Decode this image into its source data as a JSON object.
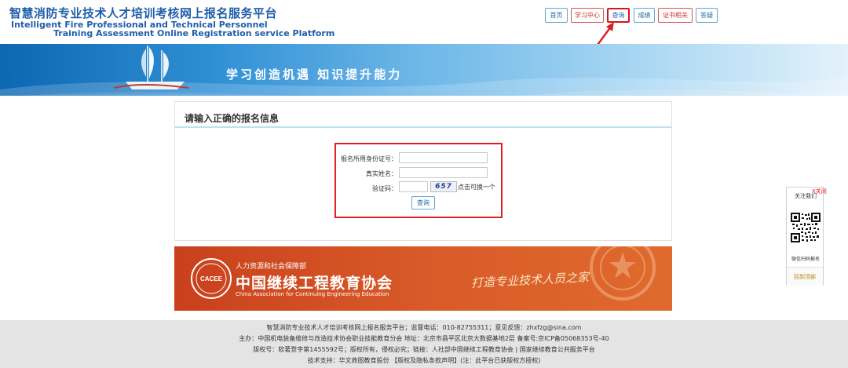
{
  "header": {
    "title_cn": "智慧消防专业技术人才培训考核网上报名服务平台",
    "title_en_line1": "Intelligent Fire Professional and Technical Personnel",
    "title_en_line2": "Training Assessment Online Registration service Platform"
  },
  "nav": {
    "items": [
      {
        "label": "首页",
        "state": "normal"
      },
      {
        "label": "学习中心",
        "state": "red"
      },
      {
        "label": "查询",
        "state": "current"
      },
      {
        "label": "成绩",
        "state": "normal"
      },
      {
        "label": "证书相关",
        "state": "red"
      },
      {
        "label": "答疑",
        "state": "normal"
      }
    ]
  },
  "banner": {
    "slogan": "学习创造机遇  知识提升能力"
  },
  "form": {
    "title": "请输入正确的报名信息",
    "id_label": "报名所用身份证号：",
    "name_label": "真实姓名：",
    "captcha_label": "验证码：",
    "captcha_code": "657",
    "captcha_hint": "点击可换一个",
    "submit_label": "查询",
    "id_value": "",
    "name_value": "",
    "captcha_value": ""
  },
  "cacee": {
    "subtitle": "人力资源和社会保障部",
    "name": "中国继续工程教育协会",
    "name_en": "China Association for Continuing Engineering Education",
    "emblem_text": "CACEE",
    "slogan": "打造专业技术人员之家"
  },
  "side": {
    "title": "关注我们",
    "close": "X关闭",
    "caption": "微信扫码报名",
    "back_top": "回到顶部"
  },
  "footer": {
    "lines": [
      "智慧消防专业技术人才培训考核网上报名服务平台；监督电话：010-82755311；意见反馈：zhxfzg@sina.com",
      "主办：中国机电装备维修与改造技术协会职业技能教育分会 地址：北京市昌平区北京大数据基地2层 备案号:京ICP备05068353号-40",
      "版权号：软著登字第1455592号；版权所有，侵权必究；链接：人社部中国继续工程教育协会 | 国家继续教育公共服务平台",
      "技术支持：华文燕图教育股份 【版权及隐私条款声明】(注：此平台已获版权方授权)"
    ]
  },
  "colors": {
    "brand_blue": "#1f5fa8",
    "highlight_red": "#e01e24",
    "cacee_orange": "#d85a28"
  }
}
